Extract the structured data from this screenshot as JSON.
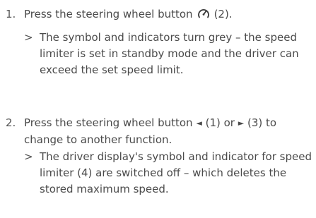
{
  "steps": [
    {
      "number": "1.",
      "text_before_icon": "Press the steering wheel button",
      "icon": "speed-limiter-icon",
      "text_after_icon": "(2).",
      "result_marker": ">",
      "result_text": "The symbol and indicators turn grey – the speed limiter is set in standby mode and the driver can exceed the set speed limit."
    },
    {
      "number": "2.",
      "text_part1": "Press the steering wheel button",
      "left_arrow_glyph": "◄",
      "text_part2": "(1) or",
      "right_arrow_glyph": "►",
      "text_part3": "(3) to change to another function.",
      "result_marker": ">",
      "result_text": "The driver display's symbol and indicator for speed limiter (4) are switched off – which deletes the stored maximum speed."
    }
  ]
}
